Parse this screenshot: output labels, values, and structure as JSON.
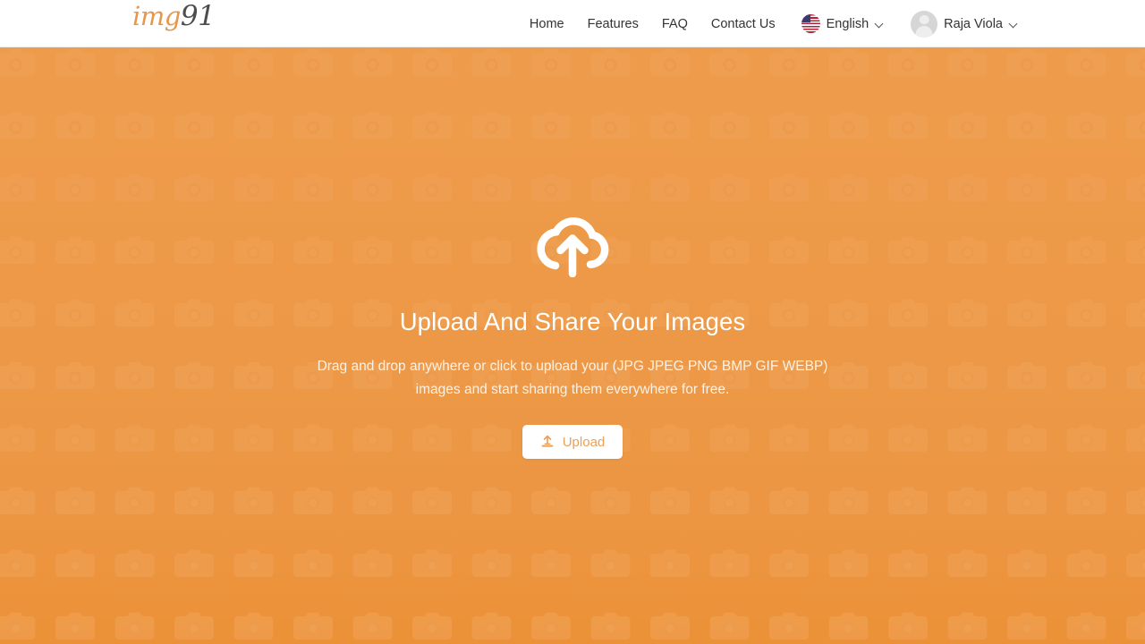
{
  "header": {
    "logo": {
      "primary": "img",
      "secondary": "91",
      "name": "img91"
    },
    "nav_items": [
      {
        "label": "Home",
        "name": "nav-link-home"
      },
      {
        "label": "Features",
        "name": "nav-link-features"
      },
      {
        "label": "FAQ",
        "name": "nav-link-faq"
      },
      {
        "label": "Contact Us",
        "name": "nav-link-contact-us"
      }
    ],
    "language": {
      "label": "English",
      "flag_icon": "us-flag-icon",
      "chevron_icon": "chevron-down-icon"
    },
    "user": {
      "name": "Raja Viola",
      "avatar_icon": "avatar-placeholder-icon",
      "chevron_icon": "chevron-down-icon"
    }
  },
  "hero": {
    "upload_icon": "cloud-upload-icon",
    "title": "Upload And Share Your Images",
    "subtitle_line1": "Drag and drop anywhere or click to upload your (JPG JPEG PNG BMP GIF WEBP)",
    "subtitle_line2": "images and start sharing them everywhere for free.",
    "upload_button": {
      "label": "Upload",
      "icon": "upload-arrow-icon"
    },
    "background_pattern_icon": "camera-icon"
  },
  "colors": {
    "brand_orange": "#ed9947",
    "logo_orange": "#e8974a",
    "logo_dark": "#4d4d4d",
    "nav_text": "#333333",
    "hero_text": "#ffffff",
    "hero_subtext": "#fdf1e4",
    "button_bg": "#ffffff",
    "button_text": "#eda056",
    "header_bg": "#ffffff",
    "header_border": "#ededed",
    "avatar_bg": "#d6d6d6"
  }
}
